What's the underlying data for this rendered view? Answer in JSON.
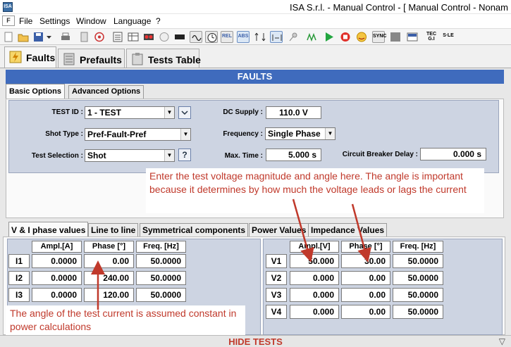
{
  "window": {
    "title": "ISA S.r.l. - Manual Control - [ Manual Control - Nonam"
  },
  "menu": {
    "items": [
      "File",
      "Settings",
      "Window",
      "Language",
      "?"
    ]
  },
  "toolbar": {
    "txt_rel": "REL",
    "txt_abs": "ABS",
    "txt_sync": "SYNC",
    "txt_tec": "TEC\nG.I",
    "txt_sle": "S∙LE"
  },
  "main_tabs": {
    "faults": "Faults",
    "prefaults": "Prefaults",
    "tests_table": "Tests Table"
  },
  "section_header": "FAULTS",
  "sub_tabs": {
    "basic": "Basic Options",
    "advanced": "Advanced Options"
  },
  "basic": {
    "test_id_label": "TEST ID :",
    "test_id_value": "1 - TEST",
    "shot_type_label": "Shot Type :",
    "shot_type_value": "Pref-Fault-Pref",
    "test_selection_label": "Test Selection :",
    "test_selection_value": "Shot",
    "dc_supply_label": "DC Supply :",
    "dc_supply_value": "110.0 V",
    "frequency_label": "Frequency :",
    "frequency_value": "Single Phase",
    "max_time_label": "Max. Time :",
    "max_time_value": "5.000 s",
    "cb_delay_label": "Circuit Breaker Delay :",
    "cb_delay_value": "0.000 s",
    "help_glyph": "?"
  },
  "annotations": {
    "voltage": "Enter the test voltage magnitude and angle here.  The angle is important because it determines by how much the voltage leads or lags the current",
    "current": "The angle of the test current is assumed constant in power calculations"
  },
  "value_tabs": [
    "V & I phase values",
    "Line to line",
    "Symmetrical components",
    "Power Values",
    "Impedance Values"
  ],
  "current_table": {
    "headers": [
      "Ampl.[A]",
      "Phase [°]",
      "Freq. [Hz]"
    ],
    "rows": [
      {
        "label": "I1",
        "ampl": "0.0000",
        "phase": "0.00",
        "freq": "50.0000"
      },
      {
        "label": "I2",
        "ampl": "0.0000",
        "phase": "240.00",
        "freq": "50.0000"
      },
      {
        "label": "I3",
        "ampl": "0.0000",
        "phase": "120.00",
        "freq": "50.0000"
      }
    ]
  },
  "voltage_table": {
    "headers": [
      "Ampl.[V]",
      "Phase [°]",
      "Freq. [Hz]"
    ],
    "rows": [
      {
        "label": "V1",
        "ampl": "50.000",
        "phase": "30.00",
        "freq": "50.0000"
      },
      {
        "label": "V2",
        "ampl": "0.000",
        "phase": "0.00",
        "freq": "50.0000"
      },
      {
        "label": "V3",
        "ampl": "0.000",
        "phase": "0.00",
        "freq": "50.0000"
      },
      {
        "label": "V4",
        "ampl": "0.000",
        "phase": "0.00",
        "freq": "50.0000"
      }
    ]
  },
  "footer": {
    "hide_tests": "HIDE TESTS",
    "hide_arrow": "▽"
  },
  "colors": {
    "header_blue": "#3f6bbd",
    "annotation_red": "#c0392b",
    "panel_blue": "#cdd4e2"
  }
}
